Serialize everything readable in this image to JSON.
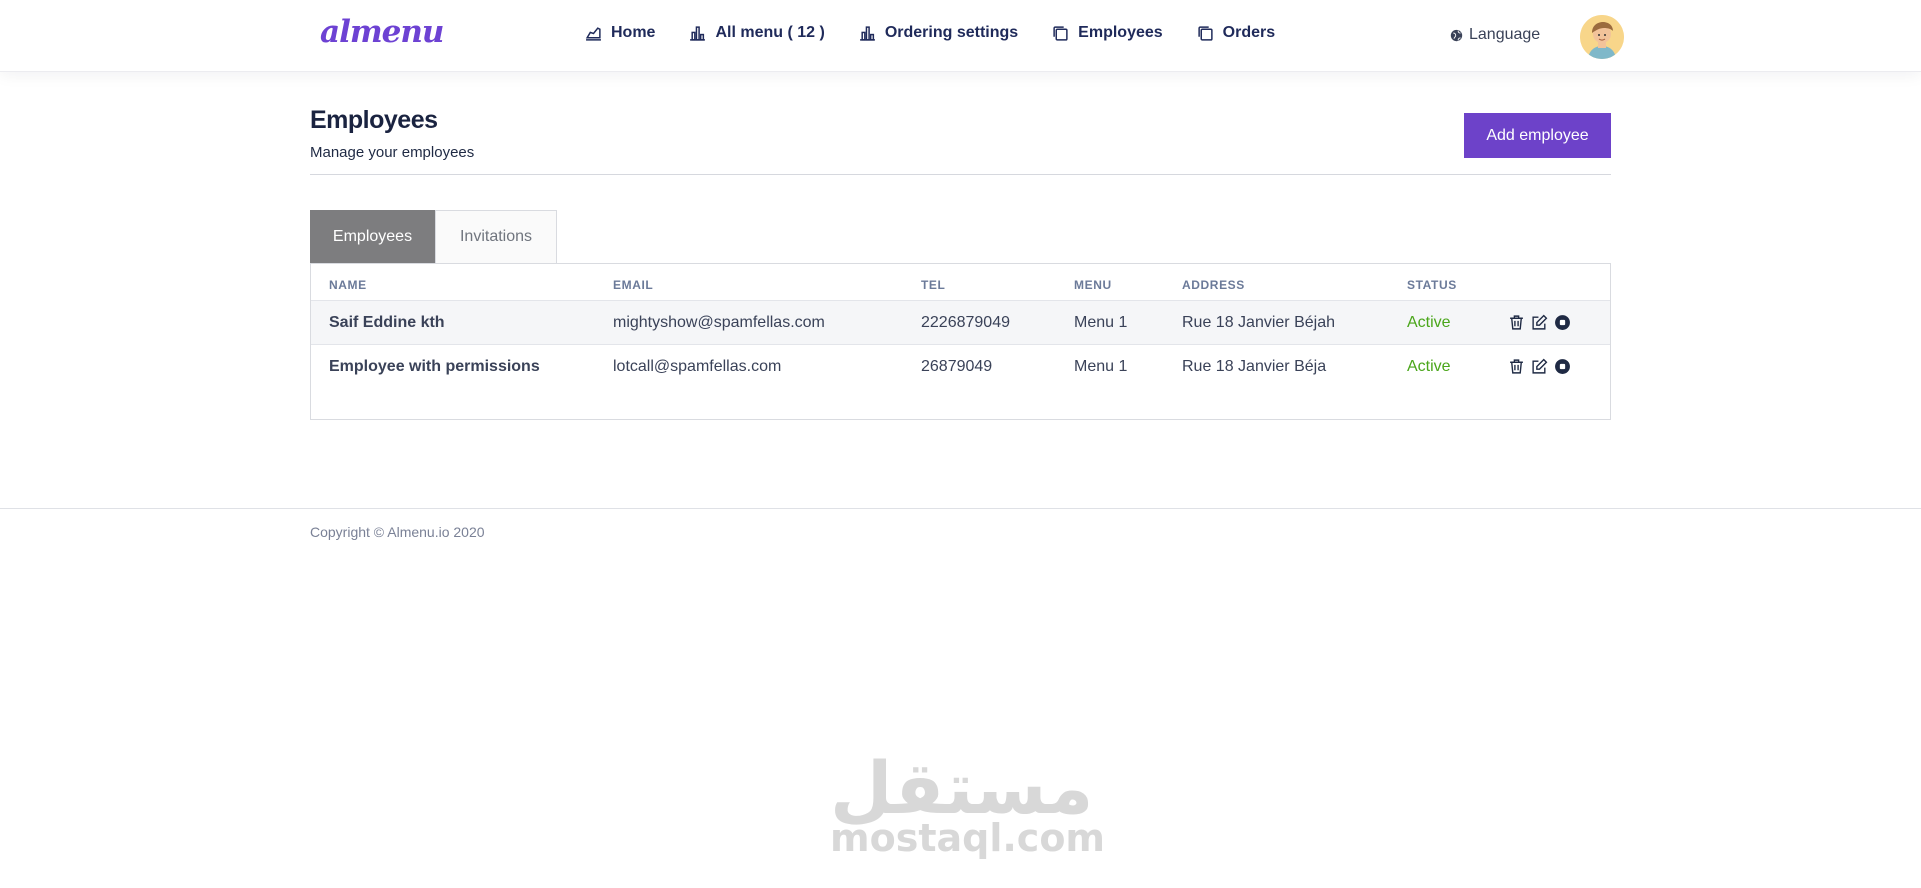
{
  "brand": {
    "logo_text": "almenu",
    "accent_color": "#6d42c9"
  },
  "nav": {
    "items": [
      {
        "label": "Home",
        "icon": "chart-line-icon"
      },
      {
        "label": "All menu ( 12 )",
        "icon": "bar-chart-icon"
      },
      {
        "label": "Ordering settings",
        "icon": "bar-chart-icon"
      },
      {
        "label": "Employees",
        "icon": "copy-icon"
      },
      {
        "label": "Orders",
        "icon": "copy-icon"
      }
    ],
    "language_label": "Language"
  },
  "page": {
    "title": "Employees",
    "subtitle": "Manage your employees",
    "add_button_label": "Add employee"
  },
  "tabs": [
    {
      "label": "Employees",
      "active": true
    },
    {
      "label": "Invitations",
      "active": false
    }
  ],
  "table": {
    "headers": {
      "name": "NAME",
      "email": "EMAIL",
      "tel": "TEL",
      "menu": "MENU",
      "address": "ADDRESS",
      "status": "STATUS"
    },
    "rows": [
      {
        "name": "Saif Eddine kth",
        "email": "mightyshow@spamfellas.com",
        "tel": "2226879049",
        "menu": "Menu 1",
        "address": "Rue 18 Janvier Béjah",
        "status": "Active"
      },
      {
        "name": "Employee with permissions",
        "email": "lotcall@spamfellas.com",
        "tel": "26879049",
        "menu": "Menu 1",
        "address": "Rue 18 Janvier Béja",
        "status": "Active"
      }
    ],
    "status_color": "#4aa61a"
  },
  "footer": {
    "copyright": "Copyright © Almenu.io 2020"
  },
  "watermark": {
    "arabic": "مستقل",
    "latin": "mostaql.com"
  }
}
